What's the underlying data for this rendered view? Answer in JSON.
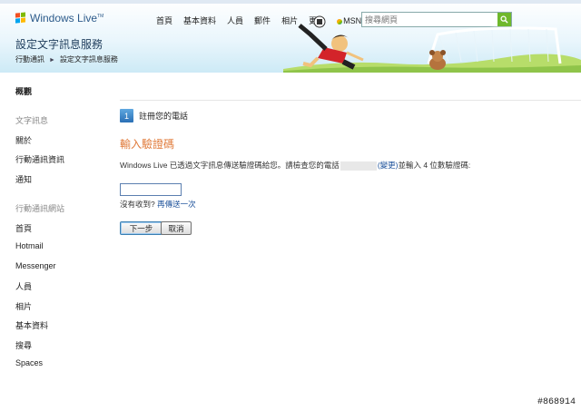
{
  "header": {
    "logo_text": "Windows Live",
    "logo_tm": "TM",
    "nav": [
      "首頁",
      "基本資料",
      "人員",
      "郵件",
      "相片",
      "更多"
    ],
    "msn_label": "MSN ▾",
    "search_placeholder": "搜尋網頁",
    "page_title": "設定文字訊息服務",
    "breadcrumb": {
      "root": "行動通訊",
      "separator": "►",
      "current": "設定文字訊息服務"
    }
  },
  "sidebar": {
    "overview": "概觀",
    "section1_title": "文字訊息",
    "section1_items": [
      "關於",
      "行動通訊資訊",
      "通知"
    ],
    "section2_title": "行動通訊網站",
    "section2_items": [
      "首頁",
      "Hotmail",
      "Messenger",
      "人員",
      "相片",
      "基本資料",
      "搜尋",
      "Spaces"
    ]
  },
  "main": {
    "step_number": "1",
    "step_label": "註冊您的電話",
    "heading": "輸入驗證碼",
    "instruction_pre": "Windows Live 已透過文字訊息傳送驗證碼給您。請檢查您的電話",
    "instruction_change": "(變更)",
    "instruction_post": "並輸入 4 位數驗證碼:",
    "code_value": "",
    "no_receive": "沒有收到?",
    "resend": "再傳送一次",
    "next_button": "下一步",
    "cancel_button": "取消"
  },
  "watermark": "#868914",
  "colors": {
    "heading_orange": "#e07a3a",
    "link_blue": "#1a4f99",
    "search_green": "#6fb82c"
  }
}
